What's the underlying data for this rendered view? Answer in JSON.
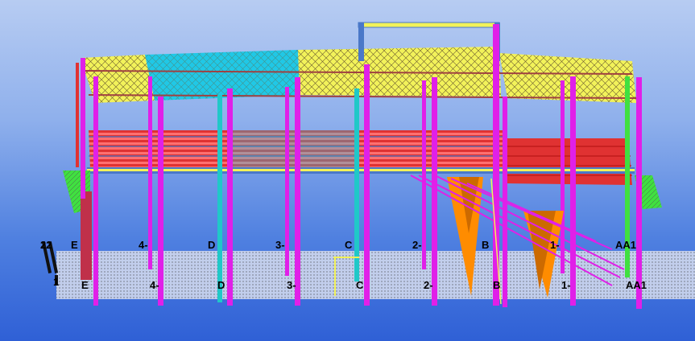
{
  "viewport": {
    "background_top": "#b7ccf2",
    "background_bottom": "#2f60d6"
  },
  "grid_labels": {
    "back_row": [
      "E",
      "4-",
      "D",
      "3-",
      "C",
      "2-",
      "B",
      "1-",
      "AA1"
    ],
    "front_row": [
      "E",
      "4-",
      "D",
      "3-",
      "C",
      "2-",
      "B",
      "1-",
      "AA1"
    ],
    "side_left_back": "22",
    "side_left_front": "1"
  },
  "colors": {
    "roof_yellow": "#f2f25a",
    "roof_cyan": "#20c8e6",
    "column_magenta": "#e020e8",
    "column_cyan": "#20c8c8",
    "beam_blue": "#4a78c8",
    "floor_red": "#e03232",
    "stair_orange": "#ff8c00",
    "ground_grid": "#c8c8c8",
    "green_accent": "#40e040"
  }
}
